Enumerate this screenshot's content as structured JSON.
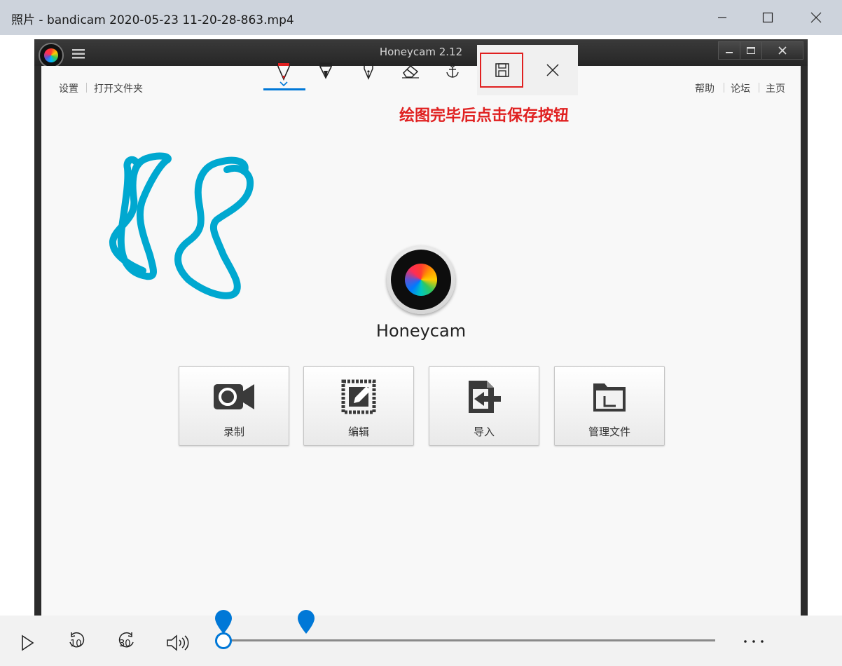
{
  "outer_window": {
    "title": "照片 - bandicam 2020-05-23 11-20-28-863.mp4",
    "minimize_icon": "minimize-icon",
    "maximize_icon": "maximize-icon",
    "close_icon": "close-icon"
  },
  "honeycam": {
    "title": "Honeycam 2.12",
    "nav_left": [
      "设置",
      "打开文件夹"
    ],
    "nav_right": [
      "帮助",
      "论坛",
      "主页"
    ],
    "logo_text": "Honeycam",
    "drawing_tools": [
      "red-pen-icon",
      "black-marker-icon",
      "fountain-pen-icon",
      "eraser-icon",
      "anchor-icon"
    ],
    "save_icon": "save-icon",
    "close_icon": "close-icon",
    "annotation": "绘图完毕后点击保存按钮",
    "annotation_color": "#e02020",
    "buttons": [
      {
        "label": "录制",
        "icon": "camera-icon"
      },
      {
        "label": "编辑",
        "icon": "edit-icon"
      },
      {
        "label": "导入",
        "icon": "import-icon"
      },
      {
        "label": "管理文件",
        "icon": "folder-icon"
      }
    ],
    "drawing_color": "#00a8d0"
  },
  "media_controls": {
    "play_icon": "play-icon",
    "rewind_label": "10",
    "forward_label": "30",
    "volume_icon": "volume-icon",
    "more_icon": "more-icon",
    "accent": "#0078d7",
    "progress": 0
  }
}
